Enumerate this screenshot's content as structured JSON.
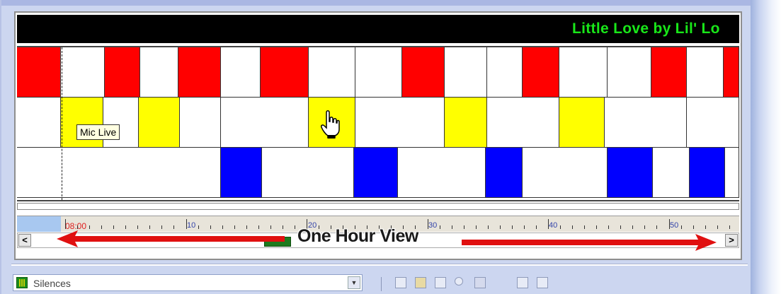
{
  "title_bar": {
    "song": "Little Love by Lil' Lo"
  },
  "tracks": [
    {
      "name": "red-track",
      "color": "#ff0000",
      "blocks": [
        [
          0,
          62,
          true
        ],
        [
          62,
          124,
          false
        ],
        [
          124,
          174,
          true
        ],
        [
          174,
          228,
          false
        ],
        [
          228,
          288,
          true
        ],
        [
          288,
          344,
          false
        ],
        [
          344,
          412,
          true
        ],
        [
          412,
          478,
          false
        ],
        [
          478,
          544,
          false
        ],
        [
          544,
          604,
          true
        ],
        [
          604,
          664,
          false
        ],
        [
          664,
          714,
          false
        ],
        [
          714,
          766,
          true
        ],
        [
          766,
          834,
          false
        ],
        [
          834,
          896,
          false
        ],
        [
          896,
          946,
          true
        ],
        [
          946,
          998,
          false
        ],
        [
          998,
          1020,
          true
        ]
      ]
    },
    {
      "name": "yellow-track",
      "color": "#ffff00",
      "blocks": [
        [
          0,
          62,
          false
        ],
        [
          62,
          122,
          true
        ],
        [
          122,
          172,
          false
        ],
        [
          172,
          230,
          true
        ],
        [
          230,
          288,
          false
        ],
        [
          288,
          412,
          false
        ],
        [
          412,
          478,
          true
        ],
        [
          478,
          604,
          false
        ],
        [
          604,
          664,
          true
        ],
        [
          664,
          766,
          false
        ],
        [
          766,
          830,
          true
        ],
        [
          830,
          946,
          false
        ],
        [
          946,
          1020,
          false
        ]
      ]
    },
    {
      "name": "blue-track",
      "color": "#0000ff",
      "blocks": [
        [
          0,
          288,
          false
        ],
        [
          288,
          346,
          true
        ],
        [
          346,
          476,
          false
        ],
        [
          476,
          538,
          true
        ],
        [
          538,
          662,
          false
        ],
        [
          662,
          714,
          true
        ],
        [
          714,
          834,
          false
        ],
        [
          834,
          898,
          true
        ],
        [
          898,
          950,
          false
        ],
        [
          950,
          1000,
          true
        ],
        [
          1000,
          1020,
          false
        ]
      ]
    }
  ],
  "tooltip": {
    "text": "Mic Live"
  },
  "ruler": {
    "current_time": "08:00",
    "labels": [
      "10",
      "20",
      "30",
      "40",
      "50"
    ]
  },
  "annotation": {
    "text": "One Hour View"
  },
  "scrollbar": {
    "left_label": "<",
    "right_label": ">"
  },
  "lower_toolbar": {
    "combo_value": "Silences",
    "combo_icon": "waveform-icon",
    "icons": [
      "new-doc-icon",
      "open-folder-icon",
      "save-icon",
      "search-icon",
      "properties-icon",
      "image-icon",
      "export-icon"
    ]
  },
  "colors": {
    "annotation_arrow": "#e01010",
    "title_text": "#19e619"
  }
}
